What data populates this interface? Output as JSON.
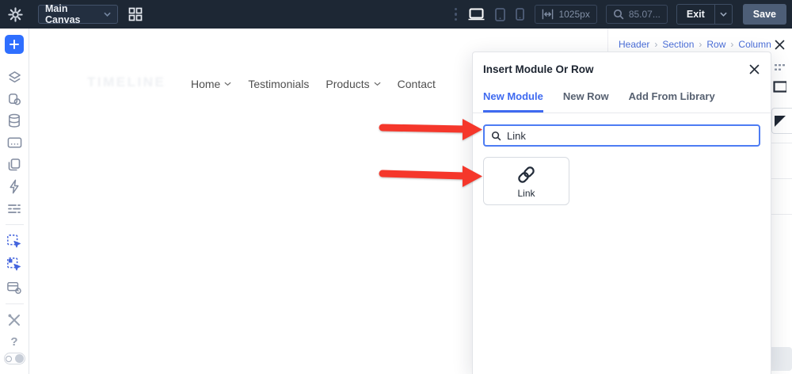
{
  "topbar": {
    "canvas_selector": "Main Canvas",
    "width_value": "1025px",
    "zoom_value": "85.07...",
    "exit_label": "Exit",
    "save_label": "Save"
  },
  "sidebar": {
    "items": [
      "add-content",
      "layers",
      "design-styles",
      "data-storage",
      "form-field",
      "duplicate",
      "quick-actions",
      "settings-list",
      "select-element",
      "select-parent",
      "box-settings",
      "tools",
      "help",
      "builder-toggle"
    ],
    "help_glyph": "?"
  },
  "canvas": {
    "logo_text": "TIMELINE",
    "nav": [
      {
        "label": "Home",
        "dropdown": true
      },
      {
        "label": "Testimonials",
        "dropdown": false
      },
      {
        "label": "Products",
        "dropdown": true
      },
      {
        "label": "Contact",
        "dropdown": false
      }
    ]
  },
  "panel": {
    "breadcrumb": [
      "Header",
      "Section",
      "Row",
      "Column"
    ],
    "separator": "›"
  },
  "modal": {
    "title": "Insert Module Or Row",
    "tabs": [
      {
        "label": "New Module",
        "active": true
      },
      {
        "label": "New Row",
        "active": false
      },
      {
        "label": "Add From Library",
        "active": false
      }
    ],
    "search_value": "Link",
    "module_label": "Link",
    "module_icon": "link-icon"
  },
  "colors": {
    "topbar_bg": "#1d2734",
    "accent_blue": "#3f6af0",
    "sidebar_blue": "#2f6fff",
    "arrow_red": "#f5372b",
    "save_bg": "#4d5e77",
    "breadcrumb_blue": "#4b6fd9"
  }
}
